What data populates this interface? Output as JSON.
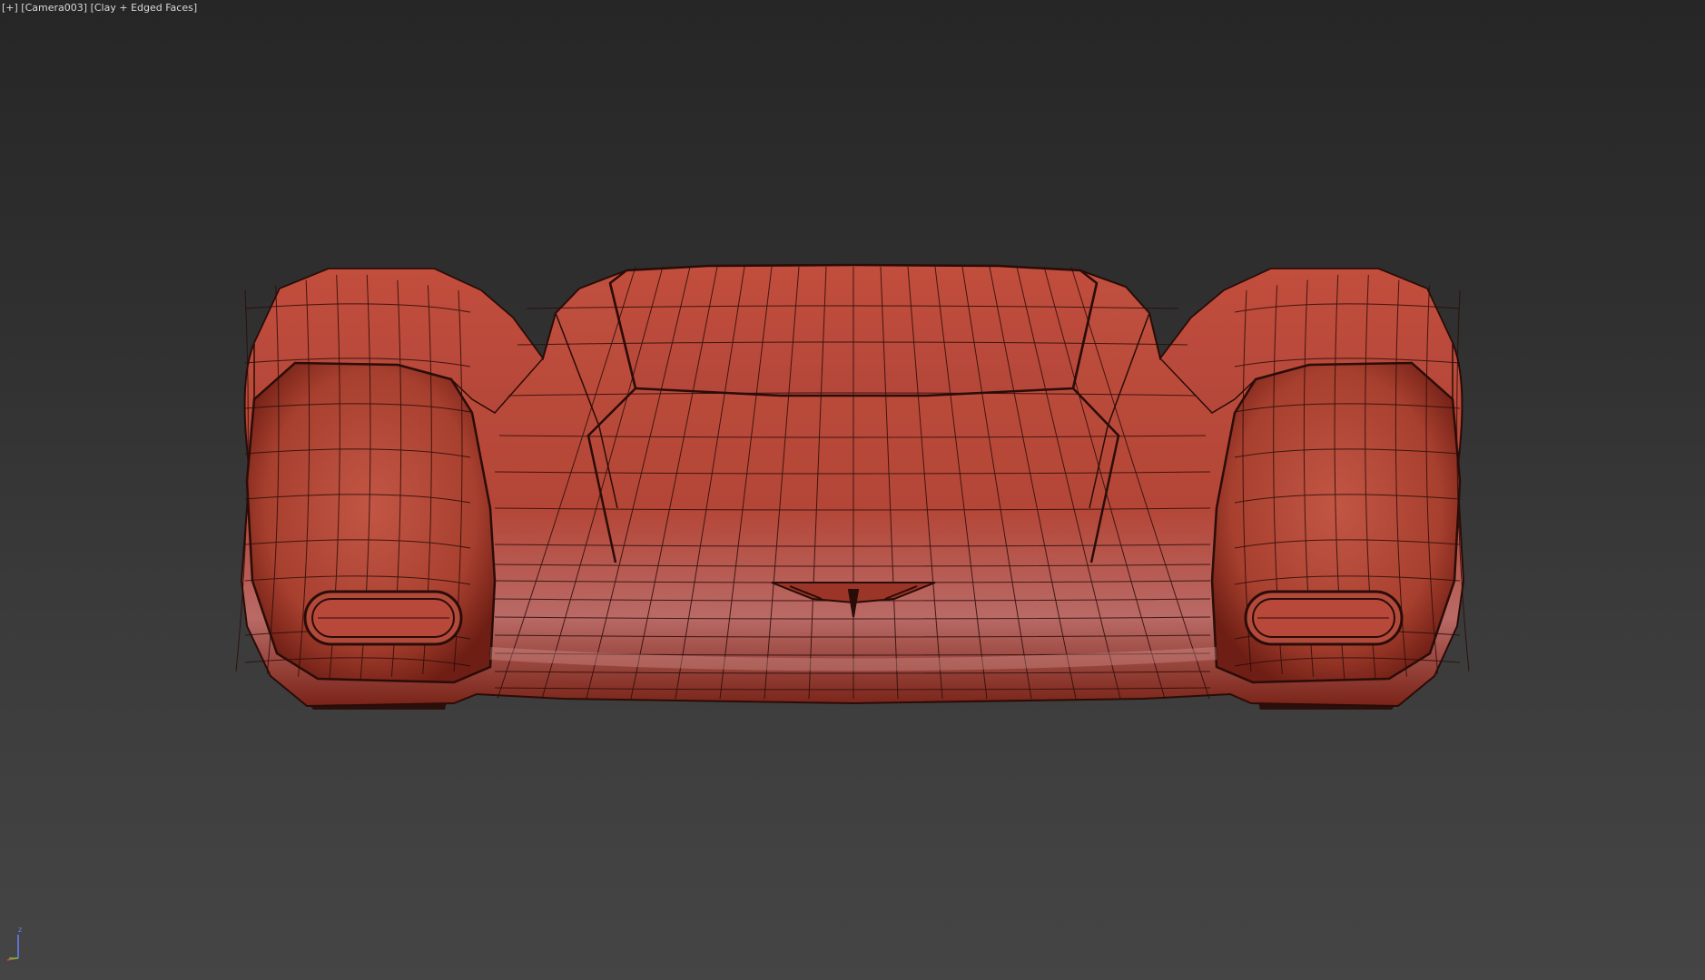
{
  "viewport": {
    "menu_label": "+",
    "camera_label": "Camera003",
    "shading_label": "Clay + Edged Faces",
    "background_top": "#262626",
    "background_bottom": "#454545"
  },
  "model": {
    "name": "car-front-clay-model",
    "clay_color": "#b84a3c",
    "wire_color": "#2a0c08"
  },
  "gizmo": {
    "z_label": "z",
    "z_color": "#6b7fff",
    "x_color": "#d44",
    "y_color": "#4c4"
  }
}
